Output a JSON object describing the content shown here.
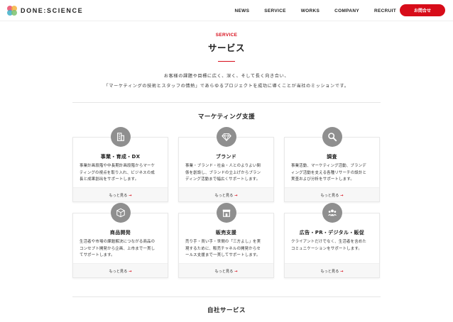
{
  "header": {
    "logo_text": "DONE:SCIENCE",
    "nav": [
      "NEWS",
      "SERVICE",
      "WORKS",
      "COMPANY",
      "RECRUIT"
    ],
    "contact_label": "お問合せ"
  },
  "section": {
    "eyebrow": "SERVICE",
    "title": "サービス",
    "lead_line1": "お客様の課題や目標に広く、深く、そして長く向き合い、",
    "lead_line2": "「マーケティングの技術とスタッフの情熱」であらゆるプロジェクトを成功に導くことが当社のミッションです。"
  },
  "marketing": {
    "title": "マーケティング支援",
    "more_label": "もっと見る",
    "cards": [
      {
        "icon": "building-icon",
        "title": "事業・育成・DX",
        "desc": [
          "事業計画段階や中長期計画段階からマーケ",
          "ティングの視点を取り入れ、ビジネスの成",
          "長と成果創出をサポートします。"
        ]
      },
      {
        "icon": "diamond-icon",
        "title": "ブランド",
        "desc": [
          "事業・ブランド・社会・人とのよりよい関",
          "係を創設し、ブランドの立上げからブラン",
          "ディング活動まで幅広くサポートします。"
        ]
      },
      {
        "icon": "search-icon",
        "title": "調査",
        "desc": [
          "事業活動、マーケティング活動、ブランデ",
          "ィング活動を支える各種リサーチの設計と",
          "実査および分析をサポートします。"
        ]
      },
      {
        "icon": "box-icon",
        "title": "商品開発",
        "desc": [
          "生活者や市場の課題解決につながる商品の",
          "コンセプト開発から企画、上市まで一貫し",
          "てサポートします。"
        ]
      },
      {
        "icon": "store-icon",
        "title": "販売支援",
        "desc": [
          "売り手・買い手・世間の「三方よし」を実",
          "現するために、販売チャネルの開発からセ",
          "ールス支援まで一貫してサポートします。"
        ]
      },
      {
        "icon": "people-icon",
        "title": "広告・PR・デジタル・販促",
        "desc": [
          "クライアントだけでなく、生活者を含めた",
          "コミュニケーションをサポートします。"
        ]
      }
    ]
  },
  "own_services": {
    "title": "自社サービス"
  }
}
